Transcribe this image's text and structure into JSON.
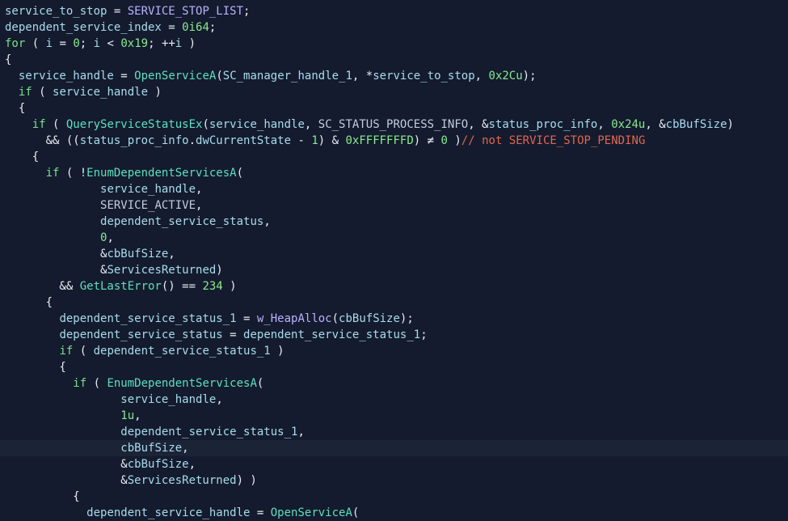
{
  "colors": {
    "background": "#141b2e",
    "current_line": "#1b2336",
    "identifier": "#a8dced",
    "function": "#5de0bf",
    "keyword": "#79e08b",
    "number": "#8be98f",
    "macro": "#b9b3ff",
    "constant": "#c2cce0",
    "operator": "#e8ecf3",
    "comment": "#e2664f"
  },
  "editor": {
    "current_line_index": 27,
    "lines": [
      [
        [
          "service_to_stop",
          "var"
        ],
        [
          " = ",
          "op"
        ],
        [
          "SERVICE_STOP_LIST",
          "mac"
        ],
        [
          ";",
          "op"
        ]
      ],
      [
        [
          "dependent_service_index",
          "var"
        ],
        [
          " = ",
          "op"
        ],
        [
          "0i64",
          "num"
        ],
        [
          ";",
          "op"
        ]
      ],
      [
        [
          "for",
          "kw"
        ],
        [
          " ( ",
          "op"
        ],
        [
          "i",
          "var"
        ],
        [
          " = ",
          "op"
        ],
        [
          "0",
          "num"
        ],
        [
          "; ",
          "op"
        ],
        [
          "i",
          "var"
        ],
        [
          " < ",
          "op"
        ],
        [
          "0x19",
          "num"
        ],
        [
          "; ",
          "op"
        ],
        [
          "++",
          "op"
        ],
        [
          "i",
          "var"
        ],
        [
          " )",
          "op"
        ]
      ],
      [
        [
          "{",
          "op"
        ]
      ],
      [
        [
          "  ",
          "op"
        ],
        [
          "service_handle",
          "var"
        ],
        [
          " = ",
          "op"
        ],
        [
          "OpenServiceA",
          "fn"
        ],
        [
          "(",
          "op"
        ],
        [
          "SC_manager_handle_1",
          "var"
        ],
        [
          ", *",
          "op"
        ],
        [
          "service_to_stop",
          "var"
        ],
        [
          ", ",
          "op"
        ],
        [
          "0x2Cu",
          "num"
        ],
        [
          ");",
          "op"
        ]
      ],
      [
        [
          "  ",
          "op"
        ],
        [
          "if",
          "kw"
        ],
        [
          " ( ",
          "op"
        ],
        [
          "service_handle",
          "var"
        ],
        [
          " )",
          "op"
        ]
      ],
      [
        [
          "  {",
          "op"
        ]
      ],
      [
        [
          "    ",
          "op"
        ],
        [
          "if",
          "kw"
        ],
        [
          " ( ",
          "op"
        ],
        [
          "QueryServiceStatusEx",
          "fn"
        ],
        [
          "(",
          "op"
        ],
        [
          "service_handle",
          "var"
        ],
        [
          ", ",
          "op"
        ],
        [
          "SC_STATUS_PROCESS_INFO",
          "const"
        ],
        [
          ", &",
          "op"
        ],
        [
          "status_proc_info",
          "var"
        ],
        [
          ", ",
          "op"
        ],
        [
          "0x24u",
          "num"
        ],
        [
          ", &",
          "op"
        ],
        [
          "cbBufSize",
          "var"
        ],
        [
          ")",
          "op"
        ]
      ],
      [
        [
          "      && ((",
          "op"
        ],
        [
          "status_proc_info",
          "var"
        ],
        [
          ".",
          "op"
        ],
        [
          "dwCurrentState",
          "var"
        ],
        [
          " - ",
          "op"
        ],
        [
          "1",
          "num"
        ],
        [
          ") & ",
          "op"
        ],
        [
          "0xFFFFFFFD",
          "num"
        ],
        [
          ") ≠ ",
          "op"
        ],
        [
          "0",
          "num"
        ],
        [
          " )",
          "op"
        ],
        [
          "// not SERVICE_STOP_PENDING",
          "cm"
        ]
      ],
      [
        [
          "    {",
          "op"
        ]
      ],
      [
        [
          "      ",
          "op"
        ],
        [
          "if",
          "kw"
        ],
        [
          " ( !",
          "op"
        ],
        [
          "EnumDependentServicesA",
          "fn"
        ],
        [
          "(",
          "op"
        ]
      ],
      [
        [
          "              ",
          "op"
        ],
        [
          "service_handle",
          "var"
        ],
        [
          ",",
          "op"
        ]
      ],
      [
        [
          "              ",
          "op"
        ],
        [
          "SERVICE_ACTIVE",
          "const"
        ],
        [
          ",",
          "op"
        ]
      ],
      [
        [
          "              ",
          "op"
        ],
        [
          "dependent_service_status",
          "var"
        ],
        [
          ",",
          "op"
        ]
      ],
      [
        [
          "              ",
          "op"
        ],
        [
          "0",
          "num"
        ],
        [
          ",",
          "op"
        ]
      ],
      [
        [
          "              &",
          "op"
        ],
        [
          "cbBufSize",
          "var"
        ],
        [
          ",",
          "op"
        ]
      ],
      [
        [
          "              &",
          "op"
        ],
        [
          "ServicesReturned",
          "var"
        ],
        [
          ")",
          "op"
        ]
      ],
      [
        [
          "        && ",
          "op"
        ],
        [
          "GetLastError",
          "fn"
        ],
        [
          "() == ",
          "op"
        ],
        [
          "234",
          "num"
        ],
        [
          " )",
          "op"
        ]
      ],
      [
        [
          "      {",
          "op"
        ]
      ],
      [
        [
          "        ",
          "op"
        ],
        [
          "dependent_service_status_1",
          "var"
        ],
        [
          " = ",
          "op"
        ],
        [
          "w_HeapAlloc",
          "mac"
        ],
        [
          "(",
          "op"
        ],
        [
          "cbBufSize",
          "var"
        ],
        [
          ");",
          "op"
        ]
      ],
      [
        [
          "        ",
          "op"
        ],
        [
          "dependent_service_status",
          "var"
        ],
        [
          " = ",
          "op"
        ],
        [
          "dependent_service_status_1",
          "var"
        ],
        [
          ";",
          "op"
        ]
      ],
      [
        [
          "        ",
          "op"
        ],
        [
          "if",
          "kw"
        ],
        [
          " ( ",
          "op"
        ],
        [
          "dependent_service_status_1",
          "var"
        ],
        [
          " )",
          "op"
        ]
      ],
      [
        [
          "        {",
          "op"
        ]
      ],
      [
        [
          "          ",
          "op"
        ],
        [
          "if",
          "kw"
        ],
        [
          " ( ",
          "op"
        ],
        [
          "EnumDependentServicesA",
          "fn"
        ],
        [
          "(",
          "op"
        ]
      ],
      [
        [
          "                 ",
          "op"
        ],
        [
          "service_handle",
          "var"
        ],
        [
          ",",
          "op"
        ]
      ],
      [
        [
          "                 ",
          "op"
        ],
        [
          "1u",
          "num"
        ],
        [
          ",",
          "op"
        ]
      ],
      [
        [
          "                 ",
          "op"
        ],
        [
          "dependent_service_status_1",
          "var"
        ],
        [
          ",",
          "op"
        ]
      ],
      [
        [
          "                 ",
          "op"
        ],
        [
          "cbBufSize",
          "var"
        ],
        [
          ",",
          "op"
        ]
      ],
      [
        [
          "                 &",
          "op"
        ],
        [
          "cbBufSize",
          "var"
        ],
        [
          ",",
          "op"
        ]
      ],
      [
        [
          "                 &",
          "op"
        ],
        [
          "ServicesReturned",
          "var"
        ],
        [
          ") )",
          "op"
        ]
      ],
      [
        [
          "          {",
          "op"
        ]
      ],
      [
        [
          "            ",
          "op"
        ],
        [
          "dependent_service_handle",
          "var"
        ],
        [
          " = ",
          "op"
        ],
        [
          "OpenServiceA",
          "fn"
        ],
        [
          "(",
          "op"
        ]
      ]
    ]
  }
}
